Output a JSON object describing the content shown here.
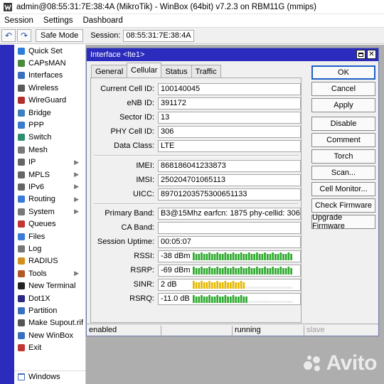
{
  "window": {
    "title": "admin@08:55:31:7E:38:4A (MikroTik) - WinBox (64bit) v7.2.3 on RBM11G (mmips)"
  },
  "menu": [
    "Session",
    "Settings",
    "Dashboard"
  ],
  "toolbar": {
    "safe_mode": "Safe Mode",
    "session_label": "Session:",
    "session_value": "08:55:31:7E:38:4A"
  },
  "sidebar": {
    "items": [
      {
        "label": "Quick Set",
        "icon": "quickset-icon",
        "arrow": false
      },
      {
        "label": "CAPsMAN",
        "icon": "capsman-icon",
        "arrow": false
      },
      {
        "label": "Interfaces",
        "icon": "interfaces-icon",
        "arrow": false
      },
      {
        "label": "Wireless",
        "icon": "wireless-icon",
        "arrow": false
      },
      {
        "label": "WireGuard",
        "icon": "wireguard-icon",
        "arrow": false
      },
      {
        "label": "Bridge",
        "icon": "bridge-icon",
        "arrow": false
      },
      {
        "label": "PPP",
        "icon": "ppp-icon",
        "arrow": false
      },
      {
        "label": "Switch",
        "icon": "switch-icon",
        "arrow": false
      },
      {
        "label": "Mesh",
        "icon": "mesh-icon",
        "arrow": false
      },
      {
        "label": "IP",
        "icon": "ip-icon",
        "arrow": true
      },
      {
        "label": "MPLS",
        "icon": "mpls-icon",
        "arrow": true
      },
      {
        "label": "IPv6",
        "icon": "ipv6-icon",
        "arrow": true
      },
      {
        "label": "Routing",
        "icon": "routing-icon",
        "arrow": true
      },
      {
        "label": "System",
        "icon": "system-icon",
        "arrow": true
      },
      {
        "label": "Queues",
        "icon": "queues-icon",
        "arrow": false
      },
      {
        "label": "Files",
        "icon": "files-icon",
        "arrow": false
      },
      {
        "label": "Log",
        "icon": "log-icon",
        "arrow": false
      },
      {
        "label": "RADIUS",
        "icon": "radius-icon",
        "arrow": false
      },
      {
        "label": "Tools",
        "icon": "tools-icon",
        "arrow": true
      },
      {
        "label": "New Terminal",
        "icon": "terminal-icon",
        "arrow": false
      },
      {
        "label": "Dot1X",
        "icon": "dot1x-icon",
        "arrow": false
      },
      {
        "label": "Partition",
        "icon": "partition-icon",
        "arrow": false
      },
      {
        "label": "Make Supout.rif",
        "icon": "supout-icon",
        "arrow": false
      },
      {
        "label": "New WinBox",
        "icon": "winbox-icon",
        "arrow": false
      },
      {
        "label": "Exit",
        "icon": "exit-icon",
        "arrow": false
      }
    ],
    "windows_label": "Windows",
    "windows_icon": "windows-icon"
  },
  "dialog": {
    "title": "Interface <lte1>",
    "tabs": [
      "General",
      "Cellular",
      "Status",
      "Traffic"
    ],
    "active_tab": "Cellular",
    "fields": {
      "current_cell_id": {
        "label": "Current Cell ID:",
        "value": "100140045"
      },
      "enb_id": {
        "label": "eNB ID:",
        "value": "391172"
      },
      "sector_id": {
        "label": "Sector ID:",
        "value": "13"
      },
      "phy_cell_id": {
        "label": "PHY Cell ID:",
        "value": "306"
      },
      "data_class": {
        "label": "Data Class:",
        "value": "LTE"
      },
      "imei": {
        "label": "IMEI:",
        "value": "868186041233873"
      },
      "imsi": {
        "label": "IMSI:",
        "value": "250204701065113"
      },
      "uicc": {
        "label": "UICC:",
        "value": "89701203575300651133"
      },
      "primary_band": {
        "label": "Primary Band:",
        "value": "B3@15Mhz earfcn: 1875 phy-cellid: 306"
      },
      "ca_band": {
        "label": "CA Band:",
        "value": ""
      },
      "session_uptime": {
        "label": "Session Uptime:",
        "value": "00:05:07"
      }
    },
    "signals": [
      {
        "key": "rssi",
        "label": "RSSI:",
        "value": "-38 dBm",
        "level": 1.0,
        "color": "#2faa2f"
      },
      {
        "key": "rsrp",
        "label": "RSRP:",
        "value": "-69 dBm",
        "level": 1.0,
        "color": "#2faa2f"
      },
      {
        "key": "sinr",
        "label": "SINR:",
        "value": "2 dB",
        "level": 0.52,
        "color": "#e6b800"
      },
      {
        "key": "rsrq",
        "label": "RSRQ:",
        "value": "-11.0 dB",
        "level": 0.55,
        "color": "#2faa2f"
      }
    ],
    "buttons": [
      "OK",
      "Cancel",
      "Apply",
      "Disable",
      "Comment",
      "Torch",
      "Scan...",
      "Cell Monitor...",
      "Check Firmware",
      "Upgrade Firmware"
    ],
    "status": {
      "enabled": "enabled",
      "running": "running",
      "slave": "slave"
    }
  },
  "watermark": "Avito"
}
